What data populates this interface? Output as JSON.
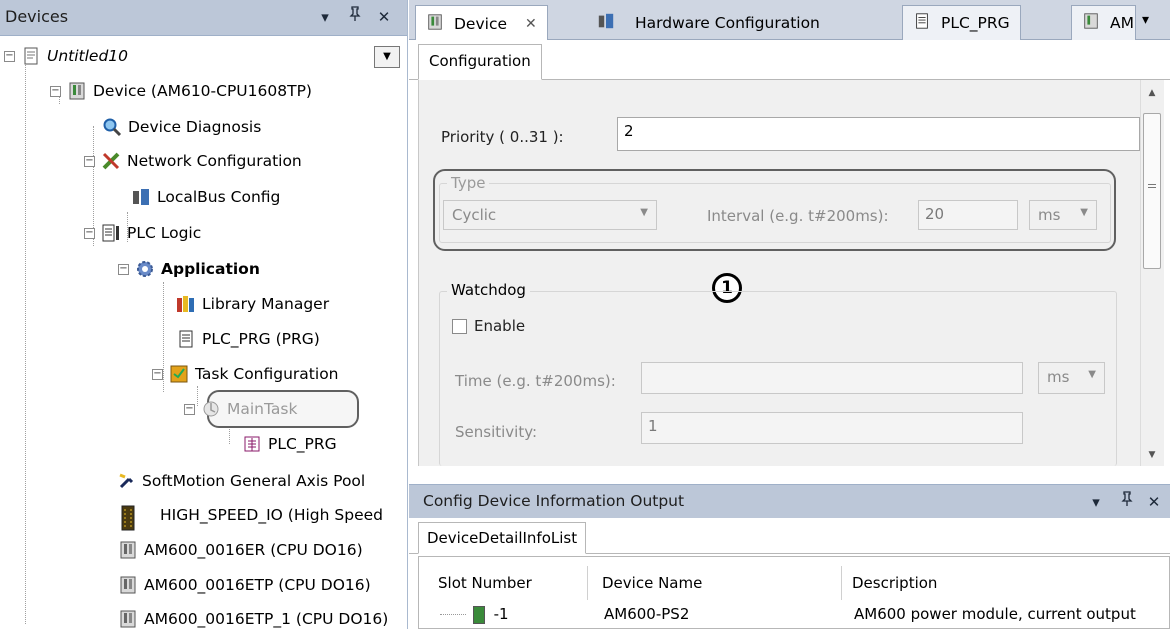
{
  "devices_panel": {
    "title": "Devices",
    "buttons": {
      "dropdown": "▾",
      "pin": "ᵖ",
      "close": "✕"
    }
  },
  "tree": {
    "project": "Untitled10",
    "device": "Device (AM610-CPU1608TP)",
    "device_diagnosis": "Device Diagnosis",
    "network_configuration": "Network Configuration",
    "localbus_config": "LocalBus Config",
    "plc_logic": "PLC Logic",
    "application": "Application",
    "library_manager": "Library Manager",
    "plc_prg": "PLC_PRG (PRG)",
    "task_configuration": "Task Configuration",
    "maintask": "MainTask",
    "maintask_plc_prg": "PLC_PRG",
    "softmotion": "SoftMotion General Axis Pool",
    "high_speed_io": "HIGH_SPEED_IO (High Speed",
    "am600_0016er": "AM600_0016ER (CPU DO16)",
    "am600_0016etp": "AM600_0016ETP (CPU DO16)",
    "am600_0016etp_1": "AM600_0016ETP_1 (CPU DO16)"
  },
  "editor_tabs": [
    {
      "label": "Device",
      "close": "✕"
    },
    {
      "label": "Hardware Configuration"
    },
    {
      "label": "PLC_PRG"
    },
    {
      "label": "AM"
    }
  ],
  "editor_tab_overflow": "▾",
  "config": {
    "tab": "Configuration",
    "priority_label": "Priority ( 0..31 ):",
    "priority_value": "2",
    "type_group": "Type",
    "type_value": "Cyclic",
    "interval_label": "Interval (e.g. t#200ms):",
    "interval_value": "20",
    "interval_unit": "ms",
    "watchdog_group": "Watchdog",
    "enable_label": "Enable",
    "time_label": "Time (e.g. t#200ms):",
    "time_value": "",
    "time_unit": "ms",
    "sensitivity_label": "Sensitivity:",
    "sensitivity_value": "1",
    "callout": "1"
  },
  "output_panel": {
    "title": "Config Device Information Output",
    "tab": "DeviceDetailInfoList",
    "columns": [
      "Slot Number",
      "Device Name",
      "Description"
    ],
    "rows": [
      {
        "slot": "-1",
        "device_name": "AM600-PS2",
        "description": "AM600 power module, current output"
      }
    ]
  },
  "colors": {
    "panel_header": "#bcc7d8",
    "tabbar": "#cfd6e2",
    "highlight_border": "#606060"
  }
}
